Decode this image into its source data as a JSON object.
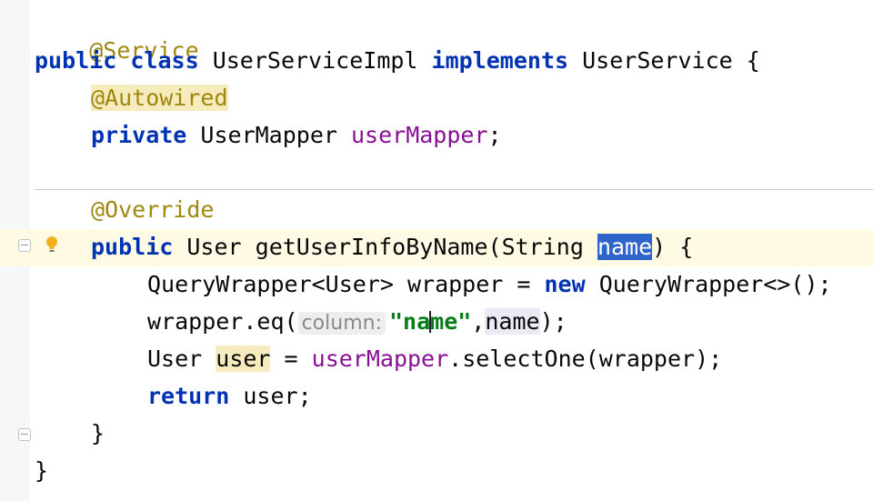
{
  "editor": {
    "gutter_icons": [
      "fold-marker-icon",
      "lightbulb-icon"
    ],
    "lines": {
      "l1": {
        "ann": "@Service"
      },
      "l2": {
        "kw1": "public",
        "kw2": "class",
        "name": "UserServiceImpl",
        "kw3": "implements",
        "iface": "UserService",
        "brace": "{"
      },
      "l3": {
        "ann": "@Autowired"
      },
      "l4": {
        "kw": "private",
        "type": "UserMapper",
        "field": "userMapper",
        "end": ";"
      },
      "l5": {
        "ann": "@Override"
      },
      "l6": {
        "kw": "public",
        "type": "User",
        "method": "getUserInfoByName(String ",
        "param": "name",
        "end": ") {"
      },
      "l7": {
        "text1": "QueryWrapper<User> wrapper = ",
        "kw": "new",
        "text2": " QueryWrapper<>();"
      },
      "l8": {
        "pre": "wrapper.eq(",
        "hint": "column:",
        "str_a": "\"na",
        "str_b": "me\"",
        "comma": ",",
        "arg": "name",
        "end": ");"
      },
      "l9": {
        "type": "User ",
        "var": "user",
        "mid": " = ",
        "field": "userMapper",
        "call": ".selectOne(wrapper);"
      },
      "l10": {
        "kw": "return",
        "rest": " user;"
      },
      "l11": {
        "text": "}"
      },
      "l12": {
        "text": "}"
      }
    }
  }
}
